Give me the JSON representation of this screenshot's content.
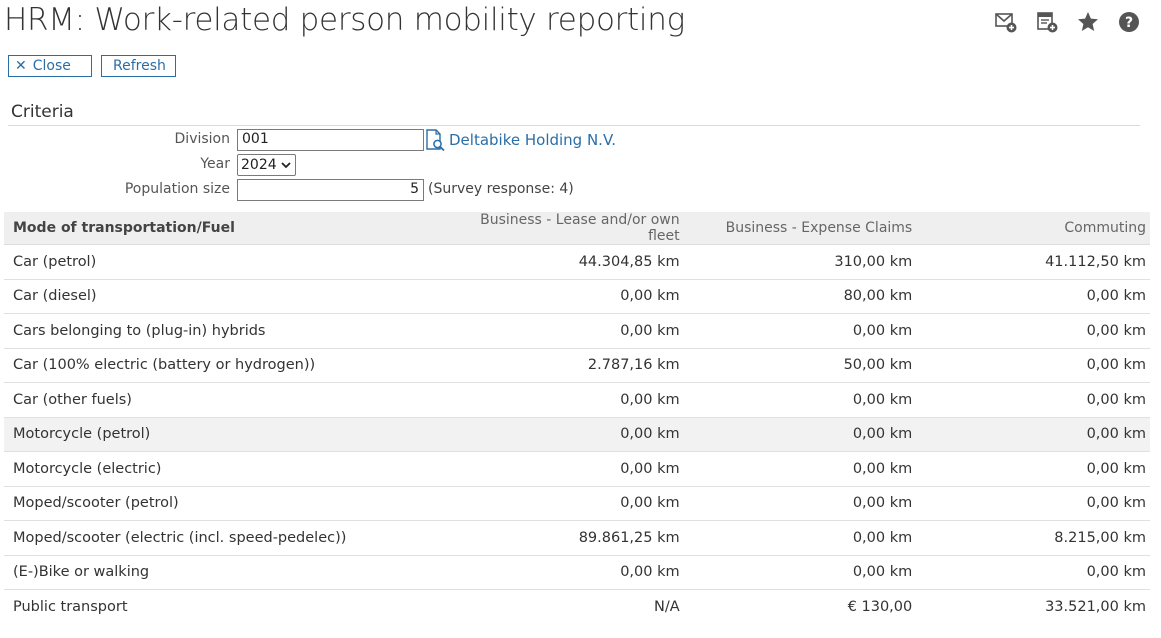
{
  "header": {
    "title": "HRM: Work-related person mobility reporting",
    "icons": [
      "mail-add-icon",
      "report-add-icon",
      "star-icon",
      "help-icon"
    ]
  },
  "toolbar": {
    "close_label": "Close",
    "refresh_label": "Refresh"
  },
  "criteria": {
    "section_title": "Criteria",
    "division_label": "Division",
    "division_value": "001",
    "division_name": "Deltabike Holding N.V.",
    "year_label": "Year",
    "year_value": "2024",
    "population_label": "Population size",
    "population_value": "5",
    "survey_response": "(Survey response: 4)"
  },
  "table": {
    "headers": [
      "Mode of transportation/Fuel",
      "Business - Lease and/or own fleet",
      "Business - Expense Claims",
      "Commuting"
    ],
    "rows": [
      [
        "Car (petrol)",
        "44.304,85 km",
        "310,00 km",
        "41.112,50 km"
      ],
      [
        "Car (diesel)",
        "0,00 km",
        "80,00 km",
        "0,00 km"
      ],
      [
        "Cars belonging to (plug-in) hybrids",
        "0,00 km",
        "0,00 km",
        "0,00 km"
      ],
      [
        "Car (100% electric (battery or hydrogen))",
        "2.787,16 km",
        "50,00 km",
        "0,00 km"
      ],
      [
        "Car (other fuels)",
        "0,00 km",
        "0,00 km",
        "0,00 km"
      ],
      [
        "Motorcycle (petrol)",
        "0,00 km",
        "0,00 km",
        "0,00 km"
      ],
      [
        "Motorcycle (electric)",
        "0,00 km",
        "0,00 km",
        "0,00 km"
      ],
      [
        "Moped/scooter (petrol)",
        "0,00 km",
        "0,00 km",
        "0,00 km"
      ],
      [
        "Moped/scooter (electric (incl. speed-pedelec))",
        "89.861,25 km",
        "0,00 km",
        "8.215,00 km"
      ],
      [
        "(E-)Bike or walking",
        "0,00 km",
        "0,00 km",
        "0,00 km"
      ],
      [
        "Public transport",
        "N/A",
        "€ 130,00",
        "33.521,00 km"
      ]
    ]
  },
  "colors": {
    "accent": "#2a6ea8",
    "header_bg": "#efefef",
    "highlight_row_bg": "#f2f2f2"
  }
}
